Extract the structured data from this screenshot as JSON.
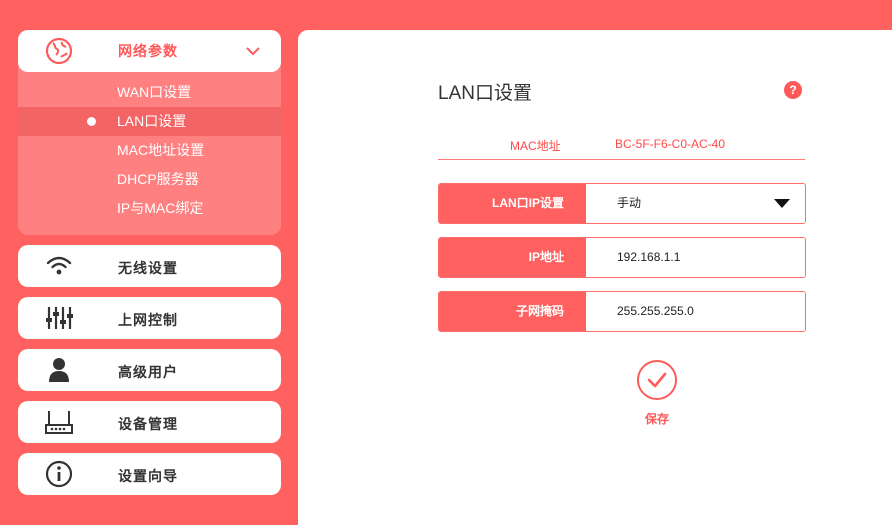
{
  "sidebar": {
    "network": {
      "label": "网络参数",
      "items": [
        {
          "label": "WAN口设置"
        },
        {
          "label": "LAN口设置"
        },
        {
          "label": "MAC地址设置"
        },
        {
          "label": "DHCP服务器"
        },
        {
          "label": "IP与MAC绑定"
        }
      ]
    },
    "nav": [
      {
        "label": "无线设置",
        "icon": "wifi-icon"
      },
      {
        "label": "上网控制",
        "icon": "sliders-icon"
      },
      {
        "label": "高级用户",
        "icon": "user-icon"
      },
      {
        "label": "设备管理",
        "icon": "router-icon"
      },
      {
        "label": "设置向导",
        "icon": "info-icon"
      }
    ]
  },
  "main": {
    "title": "LAN口设置",
    "help": "?",
    "mac": {
      "label": "MAC地址",
      "value": "BC-5F-F6-C0-AC-40"
    },
    "fields": {
      "lan_ip_mode": {
        "label": "LAN口IP设置",
        "value": "手动"
      },
      "ip_address": {
        "label": "IP地址",
        "value": "192.168.1.1"
      },
      "subnet_mask": {
        "label": "子网掩码",
        "value": "255.255.255.0"
      }
    },
    "save_label": "保存"
  },
  "colors": {
    "accent": "#ff6060",
    "accent_light": "#ff8080",
    "text": "#333333"
  }
}
